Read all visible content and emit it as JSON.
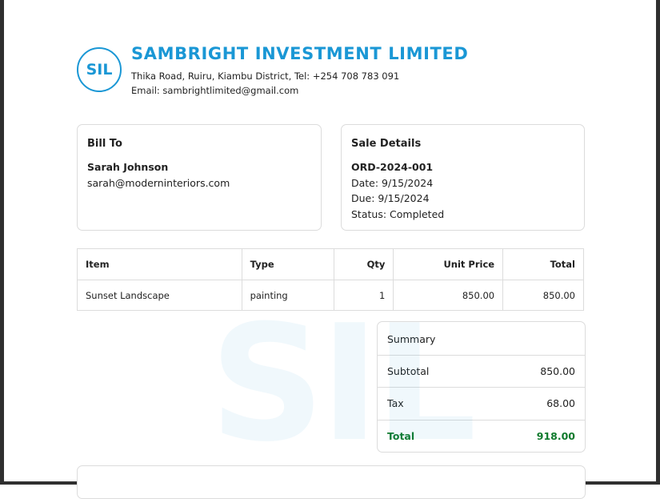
{
  "company": {
    "logo_text": "SIL",
    "name": "SAMBRIGHT INVESTMENT LIMITED",
    "address": "Thika Road, Ruiru, Kiambu District, Tel: +254 708 783 091",
    "email": "Email: sambrightlimited@gmail.com",
    "brand_color": "#1a97d5"
  },
  "bill_to": {
    "title": "Bill To",
    "name": "Sarah Johnson",
    "email": "sarah@moderninteriors.com"
  },
  "sale_details": {
    "title": "Sale Details",
    "order_id": "ORD-2024-001",
    "date": "Date: 9/15/2024",
    "due": "Due: 9/15/2024",
    "status": "Status: Completed"
  },
  "items_table": {
    "headers": [
      "Item",
      "Type",
      "Qty",
      "Unit Price",
      "Total"
    ],
    "rows": [
      [
        "Sunset Landscape",
        "painting",
        "1",
        "850.00",
        "850.00"
      ]
    ]
  },
  "summary": {
    "title": "Summary",
    "subtotal_label": "Subtotal",
    "subtotal_value": "850.00",
    "tax_label": "Tax",
    "tax_value": "68.00",
    "total_label": "Total",
    "total_value": "918.00",
    "total_color": "#0f7a2c"
  },
  "watermark": "SIL"
}
